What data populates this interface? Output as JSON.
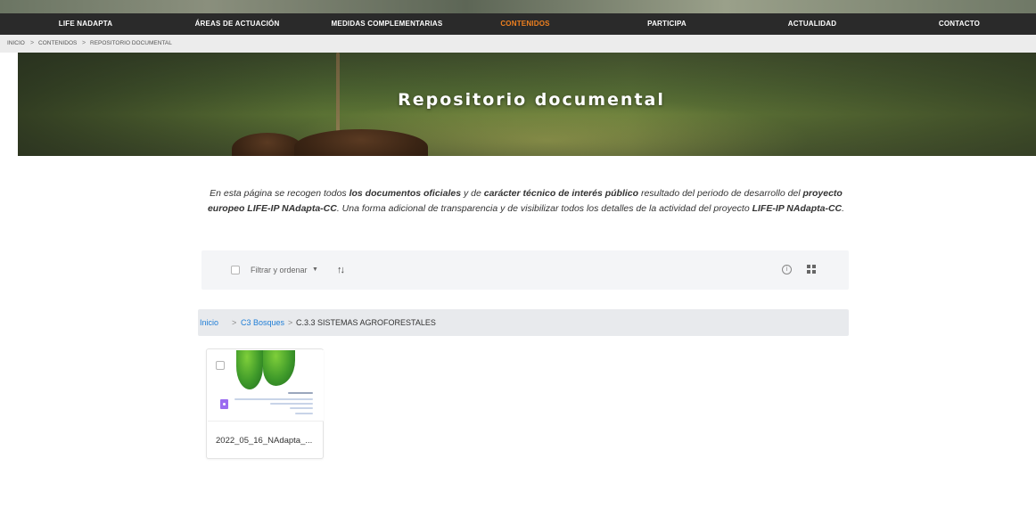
{
  "nav": {
    "items": [
      "LIFE NAdapta",
      "ÁREAS DE ACTUACIÓN",
      "MEDIDAS COMPLEMENTARIAS",
      "CONTENIDOS",
      "PARTICIPA",
      "ACTUALIDAD",
      "CONTACTO"
    ],
    "active_index": 3,
    "active_color": "#f0811f"
  },
  "breadcrumb": {
    "items": [
      "INICIO",
      "CONTENIDOS",
      "REPOSITORIO DOCUMENTAL"
    ],
    "separator": ">"
  },
  "hero": {
    "title": "Repositorio documental"
  },
  "intro": {
    "p1": "En esta página se recogen todos ",
    "b1": "los documentos oficiales",
    "p2": " y de ",
    "b2": "carácter técnico de interés público",
    "p3": " resultado del periodo de desarrollo del ",
    "b3": "proyecto europeo LIFE-IP NAdapta-CC",
    "p4": ". Una forma adicional de transparencia y de visibilizar todos los detalles de la actividad del proyecto ",
    "b4": "LIFE-IP NAdapta-CC",
    "p5": "."
  },
  "toolbar": {
    "filter_label": "Filtrar y ordenar",
    "caret": "▼",
    "sort_icon": "↑↓",
    "info_icon": "i"
  },
  "path": {
    "root": "Inicio",
    "level1": "C3 Bosques",
    "current": "C.3.3 SISTEMAS AGROFORESTALES",
    "separator": ">",
    "link_color": "#1f7ed6"
  },
  "files": [
    {
      "name": "2022_05_16_NAdapta_..."
    }
  ]
}
